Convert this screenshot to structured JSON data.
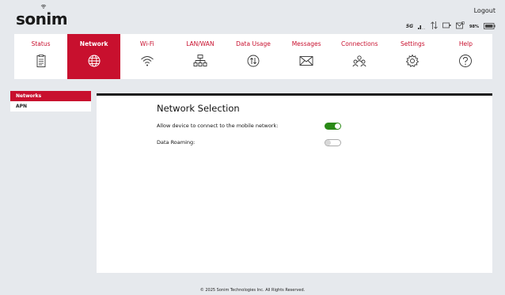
{
  "brand": {
    "logo_text": "sonim"
  },
  "header": {
    "logout_label": "Logout",
    "network_type": "5G",
    "battery_percent": "98%"
  },
  "nav": {
    "items": [
      {
        "label": "Status",
        "icon": "clipboard-icon"
      },
      {
        "label": "Network",
        "icon": "globe-icon",
        "active": true
      },
      {
        "label": "Wi-Fi",
        "icon": "wifi-icon"
      },
      {
        "label": "LAN/WAN",
        "icon": "lan-icon"
      },
      {
        "label": "Data Usage",
        "icon": "data-usage-icon"
      },
      {
        "label": "Messages",
        "icon": "envelope-icon"
      },
      {
        "label": "Connections",
        "icon": "users-icon"
      },
      {
        "label": "Settings",
        "icon": "gear-icon"
      },
      {
        "label": "Help",
        "icon": "help-icon"
      }
    ]
  },
  "sidebar": {
    "items": [
      {
        "label": "Networks",
        "active": true
      },
      {
        "label": "APN"
      }
    ]
  },
  "main": {
    "title": "Network Selection",
    "allow_connect_label": "Allow device to connect to the mobile network:",
    "allow_connect_on": true,
    "roaming_label": "Data Roaming:",
    "roaming_on": false
  },
  "footer": {
    "copyright": "© 2025 Sonim Technologies Inc. All Rights Reserved."
  },
  "colors": {
    "accent": "#c8102e",
    "toggle_on": "#2a8a16",
    "background": "#e6e9ed"
  }
}
